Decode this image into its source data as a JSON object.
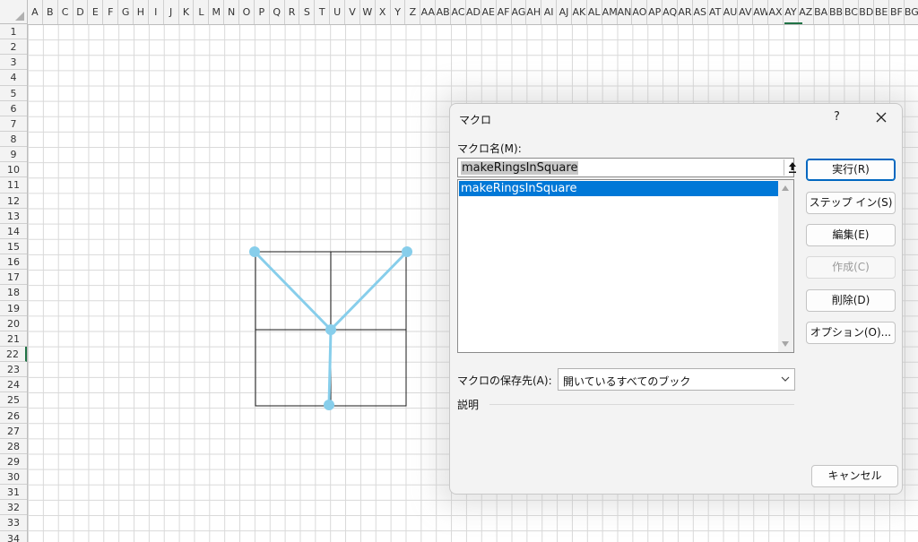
{
  "spreadsheet": {
    "columns": [
      "A",
      "B",
      "C",
      "D",
      "E",
      "F",
      "G",
      "H",
      "I",
      "J",
      "K",
      "L",
      "M",
      "N",
      "O",
      "P",
      "Q",
      "R",
      "S",
      "T",
      "U",
      "V",
      "W",
      "X",
      "Y",
      "Z",
      "AA",
      "AB",
      "AC",
      "AD",
      "AE",
      "AF",
      "AG",
      "AH",
      "AI",
      "AJ",
      "AK",
      "AL",
      "AM",
      "AN",
      "AO",
      "AP",
      "AQ",
      "AR",
      "AS",
      "AT",
      "AU",
      "AV",
      "AW",
      "AX",
      "AY",
      "AZ",
      "BA",
      "BB",
      "BC",
      "BD",
      "BE",
      "BF",
      "BG"
    ],
    "rows": [
      "1",
      "2",
      "3",
      "4",
      "5",
      "6",
      "7",
      "8",
      "9",
      "10",
      "11",
      "12",
      "13",
      "14",
      "15",
      "16",
      "17",
      "18",
      "19",
      "20",
      "21",
      "22",
      "23",
      "24",
      "25",
      "26",
      "27",
      "28",
      "29",
      "30",
      "31",
      "32",
      "33",
      "34"
    ],
    "active_row": "22",
    "shape_color": "#87ceeb",
    "line_color": "#1a1a1a"
  },
  "dialog": {
    "title": "マクロ",
    "help_label": "?",
    "name_label": "マクロ名(M):",
    "name_value": "makeRingsInSquare",
    "macros": [
      "makeRingsInSquare"
    ],
    "buttons": {
      "run": "実行(R)",
      "step_in": "ステップ イン(S)",
      "edit": "編集(E)",
      "create": "作成(C)",
      "delete": "削除(D)",
      "options": "オプション(O)...",
      "cancel": "キャンセル"
    },
    "location_label": "マクロの保存先(A):",
    "location_value": "開いているすべてのブック",
    "description_label": "説明",
    "accent_color": "#0078d7"
  }
}
